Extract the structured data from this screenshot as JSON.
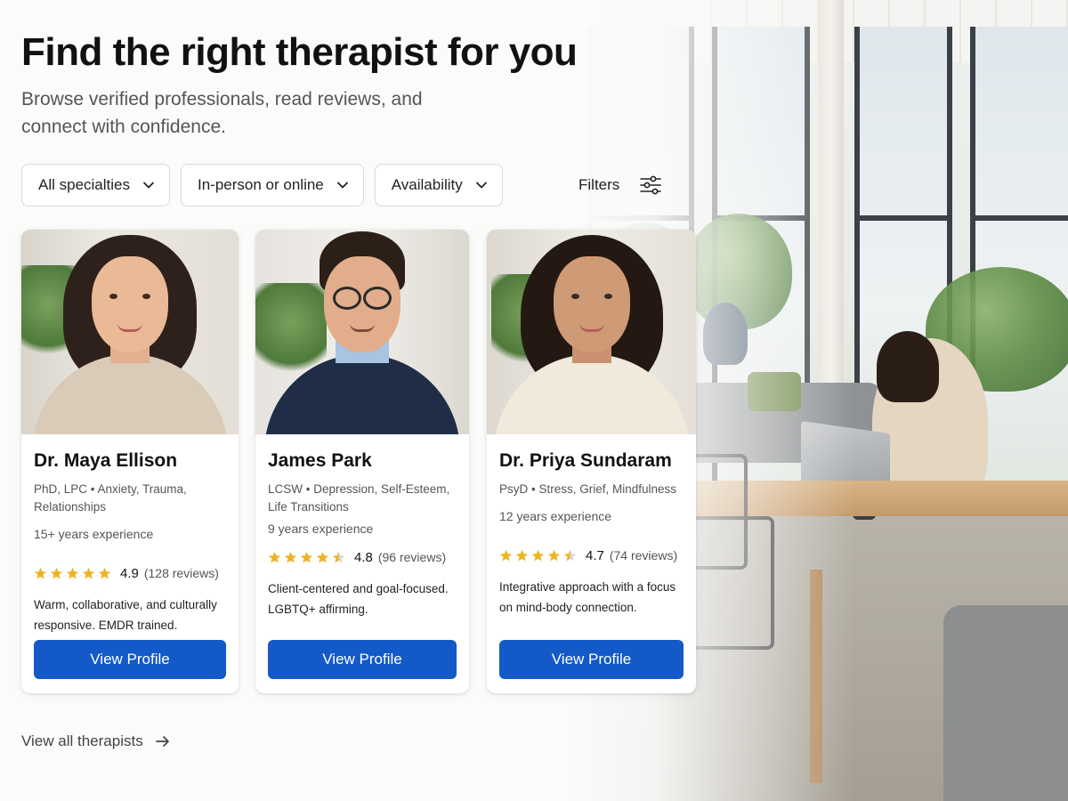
{
  "header": {
    "title": "Find the right therapist for you",
    "subtitle": "Browse verified professionals, read reviews, and connect with confidence."
  },
  "filters": {
    "items": [
      {
        "label": "All specialties",
        "icon": "chevron-down-icon"
      },
      {
        "label": "In-person or online",
        "icon": "chevron-down-icon"
      },
      {
        "label": "Availability",
        "icon": "chevron-down-icon"
      }
    ],
    "filters_label": "Filters",
    "filters_icon": "sliders-icon"
  },
  "therapists": [
    {
      "name": "Dr. Maya Ellison",
      "credentials": "PhD, LPC • Anxiety, Trauma, Relationships",
      "experience": "15+ years experience",
      "rating": 4.9,
      "rating_text": "4.9",
      "reviews": "(128 reviews)",
      "description": "Warm, collaborative, and culturally responsive. EMDR trained.",
      "cta": "View Profile"
    },
    {
      "name": "James Park",
      "credentials": "LCSW • Depression, Self-Esteem, Life Transitions",
      "experience": "9 years experience",
      "rating": 4.8,
      "rating_text": "4.8",
      "reviews": "(96 reviews)",
      "description": "Client-centered and goal-focused. LGBTQ+ affirming.",
      "cta": "View Profile"
    },
    {
      "name": "Dr. Priya Sundaram",
      "credentials": "PsyD • Stress, Grief, Mindfulness",
      "experience": "12 years experience",
      "rating": 4.7,
      "rating_text": "4.7",
      "reviews": "(74 reviews)",
      "description": "Integrative approach with a focus on mind-body connection.",
      "cta": "View Profile"
    }
  ],
  "footer": {
    "view_all": "View all therapists",
    "view_all_icon": "arrow-right-icon"
  },
  "colors": {
    "primary": "#1359c7",
    "star": "#f0b323",
    "star_empty": "#d6d6d6"
  }
}
